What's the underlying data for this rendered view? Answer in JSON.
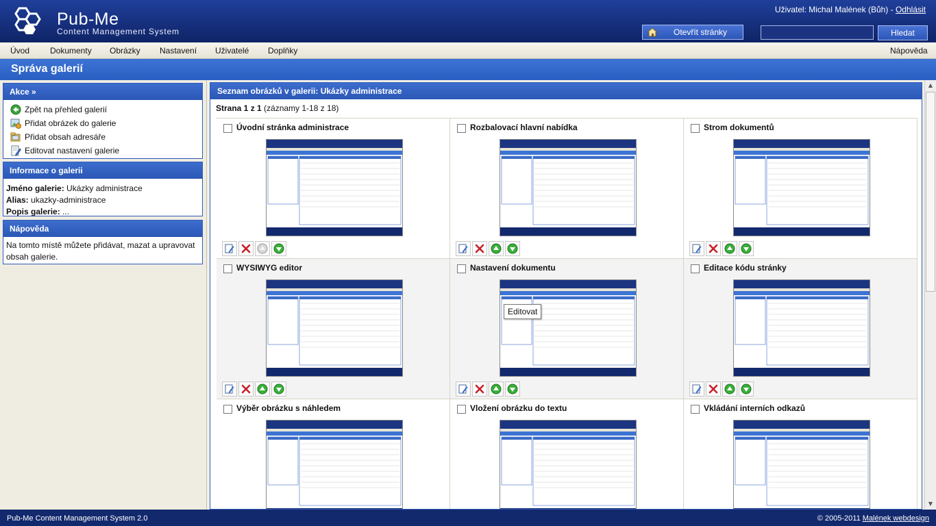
{
  "header": {
    "brand_name": "Pub-Me",
    "brand_sub": "Content Management System",
    "user_prefix": "Uživatel: Michal Malének (Bůh) - ",
    "logout": "Odhlásit",
    "open_pages": "Otevřít stránky",
    "search_value": "",
    "search_button": "Hledat"
  },
  "menu": {
    "items": [
      "Úvod",
      "Dokumenty",
      "Obrázky",
      "Nastavení",
      "Uživatelé",
      "Doplňky"
    ],
    "help": "Nápověda"
  },
  "page_title": "Správa galerií",
  "actions": {
    "title": "Akce »",
    "items": [
      {
        "label": "Zpět na přehled galerií",
        "icon": "back-arrow-icon"
      },
      {
        "label": "Přidat obrázek do galerie",
        "icon": "add-image-icon"
      },
      {
        "label": "Přidat obsah adresáře",
        "icon": "add-folder-icon"
      },
      {
        "label": "Editovat nastavení galerie",
        "icon": "edit-settings-icon"
      }
    ]
  },
  "info": {
    "title": "Informace o galerii",
    "name_label": "Jméno galerie:",
    "name_value": " Ukázky administrace",
    "alias_label": "Alias:",
    "alias_value": " ukazky-administrace",
    "desc_label": "Popis galerie:",
    "desc_value": " ..."
  },
  "help_box": {
    "title": "Nápověda",
    "text": "Na tomto místě můžete přidávat, mazat a upravovat obsah galerie."
  },
  "list": {
    "title": "Seznam obrázků v galerii: Ukázky administrace",
    "page_label": "Strana 1 z 1",
    "records": " (záznamy 1-18 z 18)",
    "items": [
      {
        "title": "Úvodní stránka administrace"
      },
      {
        "title": "Rozbalovací hlavní nabídka"
      },
      {
        "title": "Strom dokumentů"
      },
      {
        "title": "WYSIWYG editor"
      },
      {
        "title": "Nastavení dokumentu"
      },
      {
        "title": "Editace kódu stránky"
      },
      {
        "title": "Výběr obrázku s náhledem"
      },
      {
        "title": "Vložení obrázku do textu"
      },
      {
        "title": "Vkládání interních odkazů"
      }
    ],
    "tooltip": "Editovat"
  },
  "footer": {
    "left": "Pub-Me Content Management System 2.0",
    "copyright": "© 2005-2011 ",
    "link": "Malének webdesign"
  }
}
